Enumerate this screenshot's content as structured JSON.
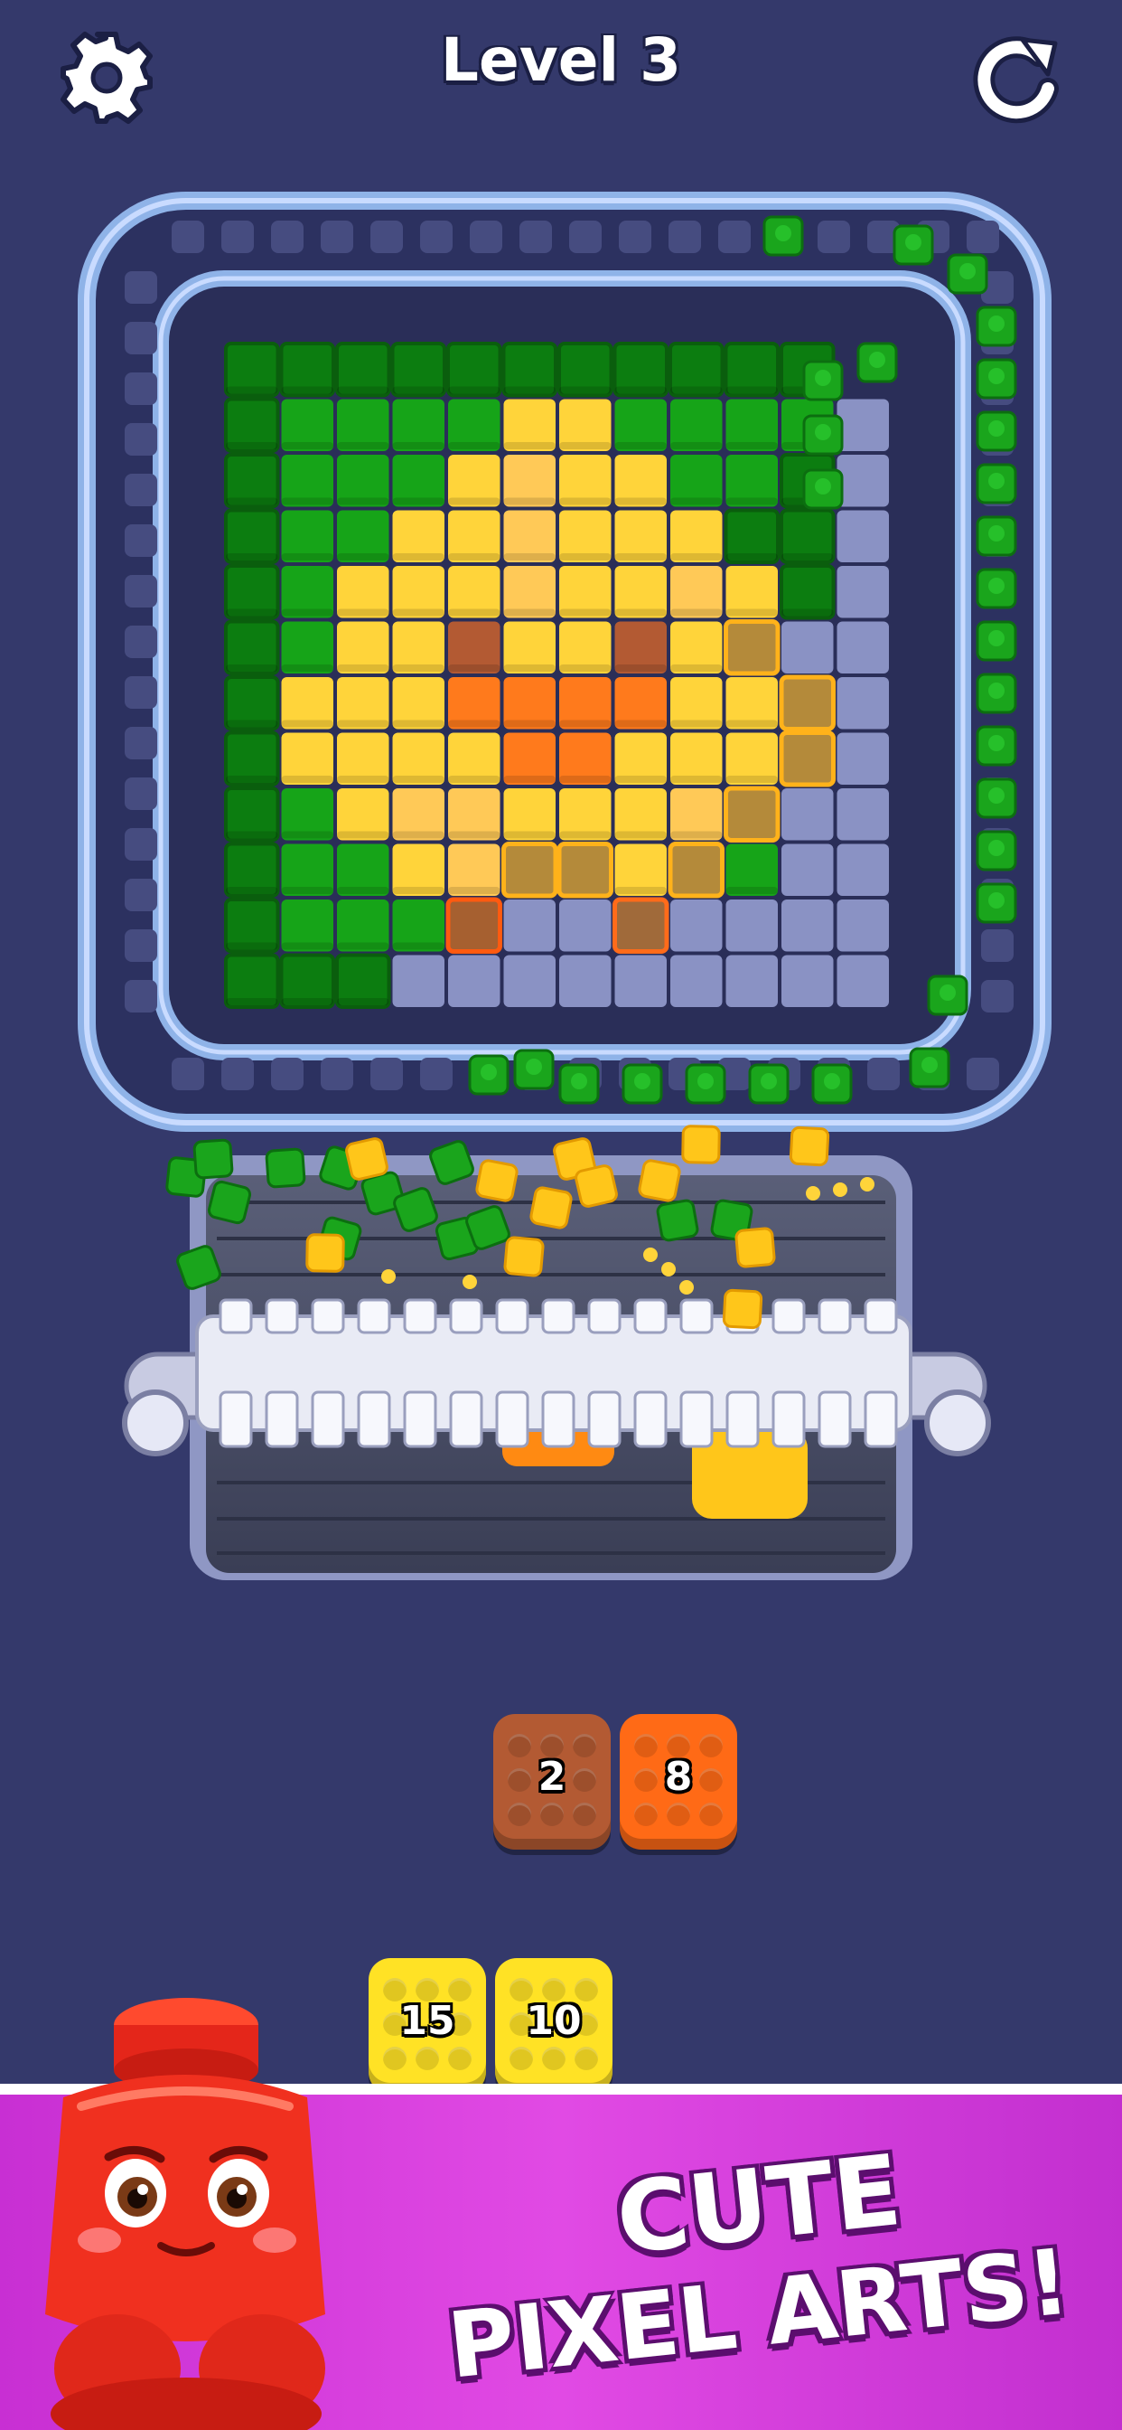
{
  "header": {
    "level_title": "Level 3",
    "settings_icon": "gear-icon",
    "restart_icon": "restart-icon"
  },
  "colors": {
    "background": "#34396b",
    "board_rail": "#8fb3e8",
    "empty_cell": "#8a92c4",
    "green": "#16a418",
    "yellow": "#ffd43a",
    "orange": "#ff7a1c",
    "brown": "#b35a33",
    "banner": "#d63ed9"
  },
  "blocks": {
    "queue_row_1": [
      {
        "count": "2",
        "color": "brown"
      },
      {
        "count": "8",
        "color": "orange"
      }
    ],
    "queue_row_2": [
      {
        "count": "15",
        "color": "yellow"
      },
      {
        "count": "10",
        "color": "yellow"
      }
    ]
  },
  "promo": {
    "line1": "CUTE",
    "line2": "PIXEL ARTS!"
  }
}
